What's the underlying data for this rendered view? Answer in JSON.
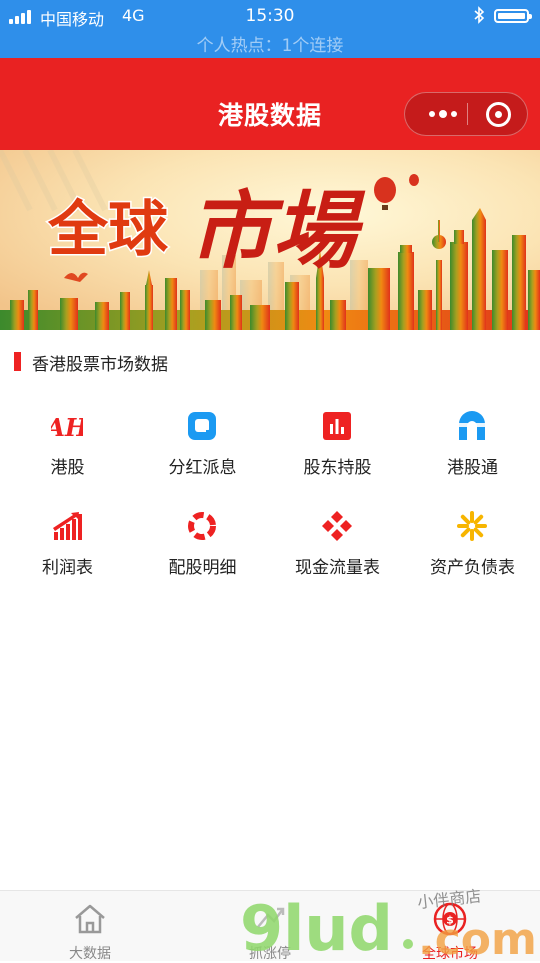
{
  "status_bar": {
    "carrier": "中国移动",
    "network": "4G",
    "time": "15:30",
    "hotspot": "个人热点：1个连接",
    "bluetooth_icon": "bluetooth-icon",
    "battery_icon": "battery-full-icon"
  },
  "header": {
    "title": "港股数据",
    "more_icon": "more-dots-icon",
    "close_icon": "target-close-icon",
    "background": "#e92222"
  },
  "banner": {
    "text_left": "全球",
    "text_right": "市場"
  },
  "section": {
    "title": "香港股票市场数据",
    "accent": "#ee2222"
  },
  "grid": [
    {
      "label": "港股",
      "icon": "ah-shares-icon"
    },
    {
      "label": "分红派息",
      "icon": "rounded-square-icon"
    },
    {
      "label": "股东持股",
      "icon": "bar-chart-icon"
    },
    {
      "label": "港股通",
      "icon": "arch-bridge-icon"
    },
    {
      "label": "利润表",
      "icon": "rising-bars-icon"
    },
    {
      "label": "配股明细",
      "icon": "ring-segments-icon"
    },
    {
      "label": "现金流量表",
      "icon": "diamond-cluster-icon"
    },
    {
      "label": "资产负债表",
      "icon": "sunburst-icon"
    }
  ],
  "tab_bar": {
    "items": [
      {
        "label": "大数据",
        "icon": "home-icon"
      },
      {
        "label": "抓涨停",
        "icon": "rising-icon"
      },
      {
        "label": "全球市场",
        "icon": "globe-dollar-icon"
      }
    ],
    "active": "全球市场",
    "active_color": "#e92222"
  },
  "watermark": {
    "text": "9lud.com",
    "sub": "小伴商店"
  }
}
